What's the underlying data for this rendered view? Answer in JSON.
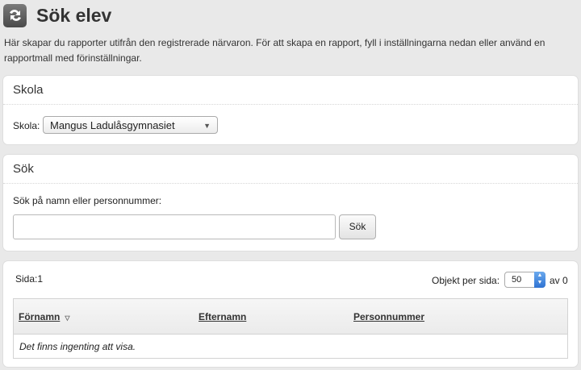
{
  "header": {
    "title": "Sök elev",
    "icon": "arrows-swap-icon"
  },
  "intro": "Här skapar du rapporter utifrån den registrerade närvaron. För att skapa en rapport, fyll i inställningarna nedan eller använd en rapportmall med förinställningar.",
  "school_panel": {
    "title": "Skola",
    "label": "Skola:",
    "selected": "Mangus Ladulåsgymnasiet"
  },
  "search_panel": {
    "title": "Sök",
    "label": "Sök på namn eller personnummer:",
    "input_value": "",
    "button": "Sök"
  },
  "results": {
    "page_label": "Sida:1",
    "per_page_label": "Objekt per sida:",
    "per_page_value": "50",
    "total": "av 0",
    "columns": [
      "Förnamn",
      "Efternamn",
      "Personnummer"
    ],
    "empty_text": "Det finns ingenting att visa."
  },
  "colors": {
    "accent": "#2f73d2",
    "background": "#e9e9e9"
  }
}
